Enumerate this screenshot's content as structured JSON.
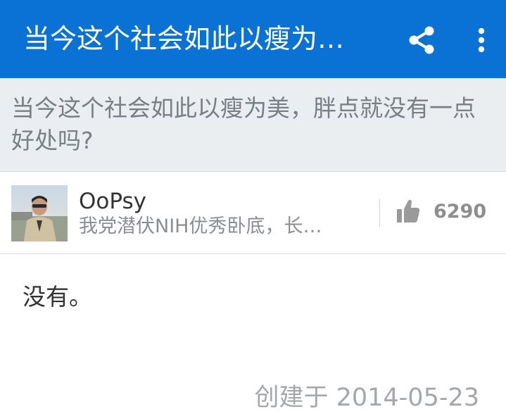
{
  "app_bar": {
    "title": "当今这个社会如此以瘦为…",
    "share_icon": "share-icon",
    "more_icon": "more-vert-icon",
    "background_color": "#0a72d4"
  },
  "question": {
    "text": "当今这个社会如此以瘦为美，胖点就没有一点好处吗?"
  },
  "author": {
    "name": "OoPsy",
    "bio": "我党潜伏NIH优秀卧底，长…",
    "avatar_icon": "avatar-photo"
  },
  "vote": {
    "icon": "thumbs-up-icon",
    "count": "6290"
  },
  "answer": {
    "body": "没有。",
    "created": "创建于 2014-05-23"
  }
}
